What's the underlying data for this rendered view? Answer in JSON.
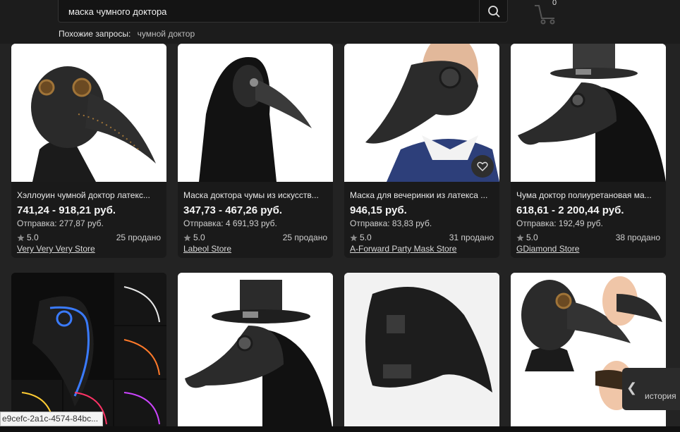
{
  "search": {
    "query": "маска чумного доктора"
  },
  "cart": {
    "count": "0"
  },
  "related": {
    "label": "Похожие запросы:",
    "query": "чумной доктор"
  },
  "products": [
    {
      "title": "Хэллоуин чумной доктор латекс...",
      "price": "741,24 - 918,21 руб.",
      "shipping": "Отправка: 277,87 руб.",
      "rating": "5.0",
      "sold": "25 продано",
      "store": "Very Very Very Store"
    },
    {
      "title": "Маска доктора чумы из искусств...",
      "price": "347,73 - 467,26 руб.",
      "shipping": "Отправка: 4 691,93 руб.",
      "rating": "5.0",
      "sold": "25 продано",
      "store": "Labeol Store"
    },
    {
      "title": "Маска для вечеринки из латекса ...",
      "price": "946,15 руб.",
      "shipping": "Отправка: 83,83 руб.",
      "rating": "5.0",
      "sold": "31 продано",
      "store": "A-Forward Party Mask Store"
    },
    {
      "title": "Чума доктор полиуретановая ма...",
      "price": "618,61 - 2 200,44 руб.",
      "shipping": "Отправка: 192,49 руб.",
      "rating": "5.0",
      "sold": "38 продано",
      "store": "GDiamond Store"
    }
  ],
  "status_url": "e9cefc-2a1c-4574-84bc...",
  "history": {
    "label": "история"
  },
  "colors": {
    "background": "#232323",
    "card": "#1a1a1a",
    "header": "#1c1c1c"
  }
}
